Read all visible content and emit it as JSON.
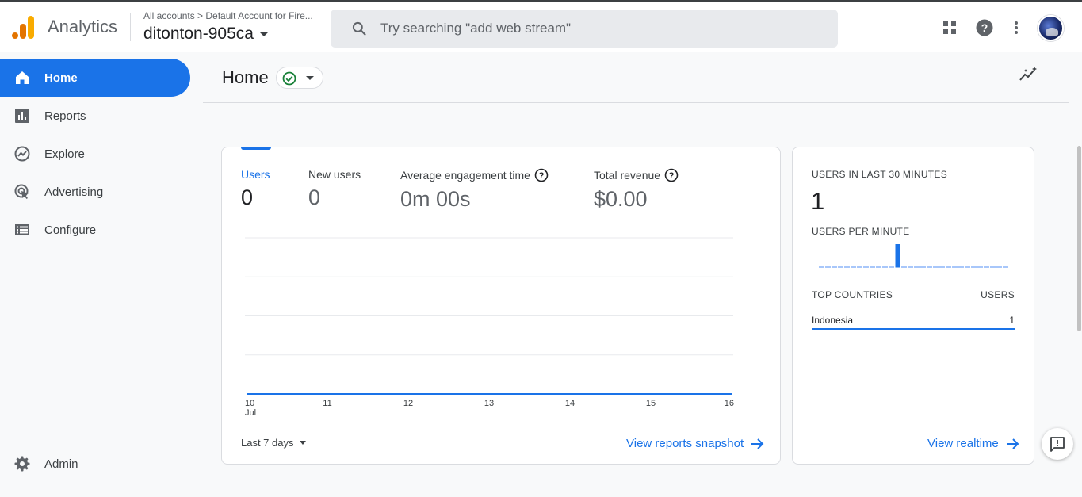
{
  "header": {
    "app_name": "Analytics",
    "breadcrumb": "All accounts > Default Account for Fire...",
    "property_name": "ditonton-905ca",
    "search_placeholder": "Try searching \"add web stream\""
  },
  "sidebar": {
    "items": [
      {
        "label": "Home",
        "icon": "home-icon",
        "active": true
      },
      {
        "label": "Reports",
        "icon": "bar-chart-icon"
      },
      {
        "label": "Explore",
        "icon": "explore-icon"
      },
      {
        "label": "Advertising",
        "icon": "advertising-icon"
      },
      {
        "label": "Configure",
        "icon": "list-icon"
      }
    ],
    "admin_label": "Admin"
  },
  "page": {
    "title": "Home"
  },
  "summary_card": {
    "metrics": [
      {
        "label": "Users",
        "value": "0"
      },
      {
        "label": "New users",
        "value": "0"
      },
      {
        "label": "Average engagement time",
        "value": "0m 00s"
      },
      {
        "label": "Total revenue",
        "value": "$0.00"
      }
    ],
    "date_range": "Last 7 days",
    "link": "View reports snapshot"
  },
  "chart_data": {
    "type": "line",
    "x": [
      "10",
      "11",
      "12",
      "13",
      "14",
      "15",
      "16"
    ],
    "x_sublabel": "Jul",
    "series": [
      {
        "values": [
          0,
          0,
          0,
          0,
          0,
          0,
          0
        ]
      }
    ],
    "gridlines": 5,
    "color": "#1a73e8"
  },
  "realtime_card": {
    "users_label": "USERS IN LAST 30 MINUTES",
    "users_value": "1",
    "per_minute_label": "USERS PER MINUTE",
    "per_minute_values": [
      0,
      0,
      0,
      0,
      0,
      0,
      0,
      0,
      0,
      0,
      0,
      0,
      1,
      0,
      0,
      0,
      0,
      0,
      0,
      0,
      0,
      0,
      0,
      0,
      0,
      0,
      0,
      0,
      0,
      0
    ],
    "table_header_country": "TOP COUNTRIES",
    "table_header_users": "USERS",
    "rows": [
      {
        "country": "Indonesia",
        "users": "1"
      }
    ],
    "link": "View realtime"
  }
}
